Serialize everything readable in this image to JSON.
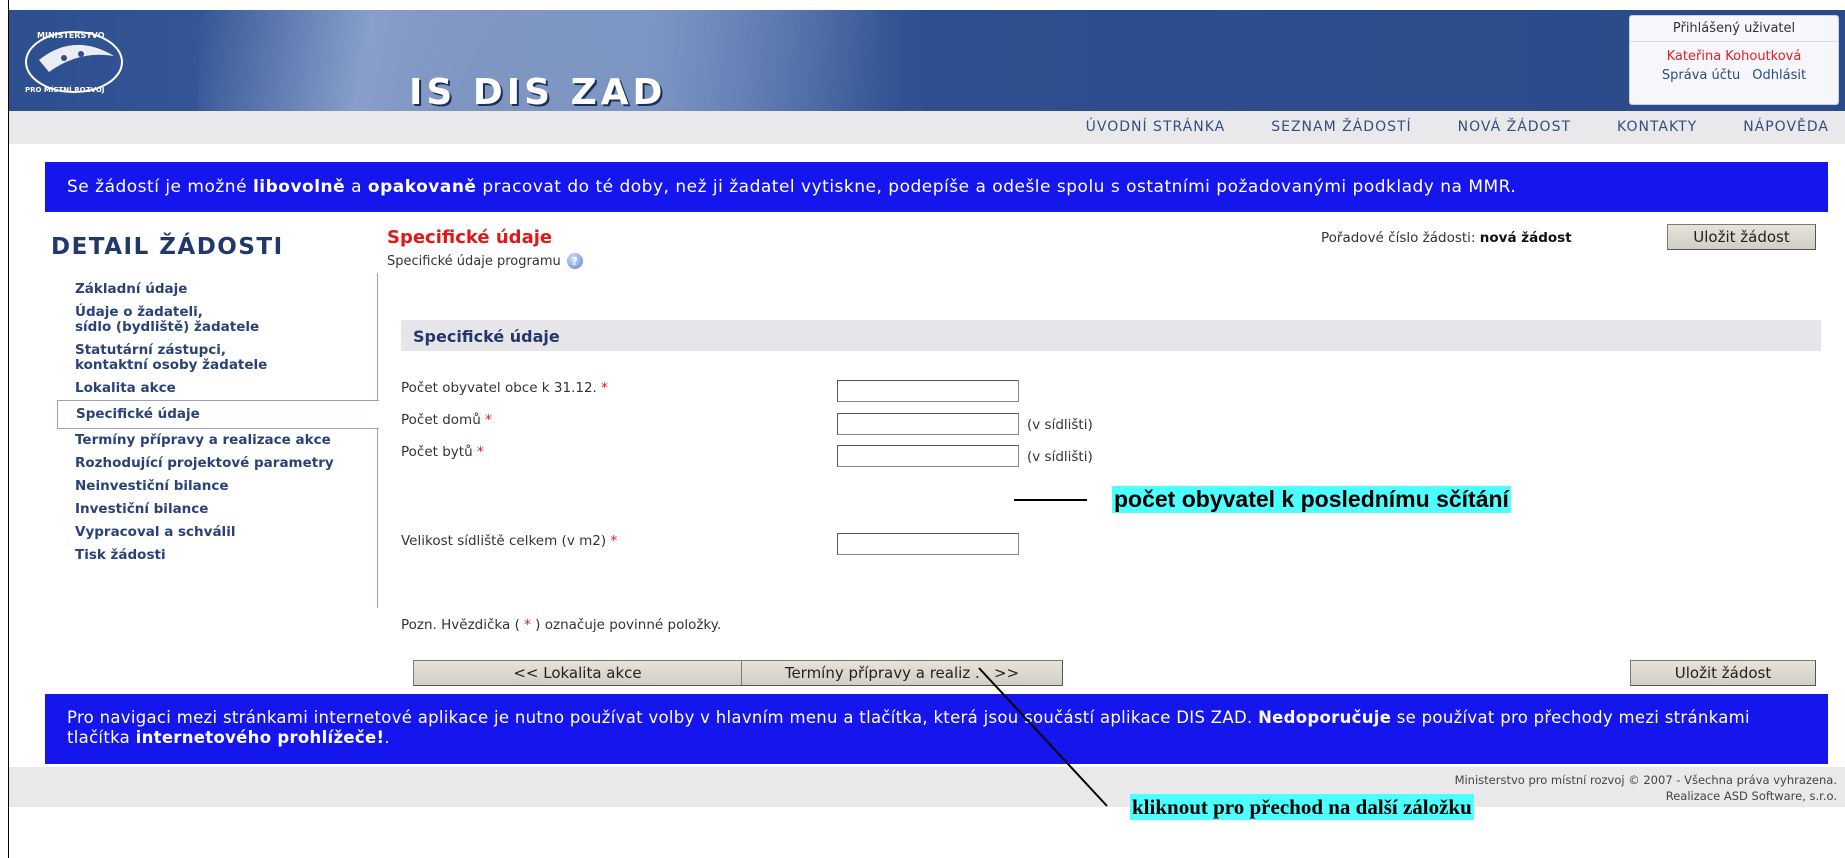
{
  "header": {
    "logo_text_top": "MINISTERSTVO",
    "logo_text_bottom": "PRO MÍSTNÍ ROZVOJ",
    "app_title": "IS DIS ZAD",
    "user_box_title": "Přihlášený uživatel",
    "user_name": "Kateřina Kohoutková",
    "account_link": "Správa účtu",
    "logout_link": "Odhlásit"
  },
  "nav": {
    "items": [
      "ÚVODNÍ STRÁNKA",
      "SEZNAM ŽÁDOSTÍ",
      "NOVÁ ŽÁDOST",
      "KONTAKTY",
      "NÁPOVĚDA"
    ]
  },
  "banner_top": {
    "p1": "Se žádostí je možné ",
    "b1": "libovolně",
    "p2": " a ",
    "b2": "opakovaně",
    "p3": " pracovat do té doby, než ji žadatel vytiskne, podepíše a odešle spolu s ostatními požadovanými podklady na MMR."
  },
  "sidebar": {
    "title": "DETAIL ŽÁDOSTI",
    "items": [
      {
        "line1": "Základní údaje",
        "line2": ""
      },
      {
        "line1": "Údaje o žadateli,",
        "line2": "sídlo (bydliště) žadatele"
      },
      {
        "line1": "Statutární zástupci,",
        "line2": "kontaktní osoby žadatele"
      },
      {
        "line1": "Lokalita akce",
        "line2": ""
      },
      {
        "line1": "Specifické údaje",
        "line2": ""
      },
      {
        "line1": "Termíny přípravy a realizace akce",
        "line2": ""
      },
      {
        "line1": "Rozhodující projektové parametry",
        "line2": ""
      },
      {
        "line1": "Neinvestiční bilance",
        "line2": ""
      },
      {
        "line1": "Investiční bilance",
        "line2": ""
      },
      {
        "line1": "Vypracoval a schválil",
        "line2": ""
      },
      {
        "line1": "Tisk žádosti",
        "line2": ""
      }
    ]
  },
  "content": {
    "section_title": "Specifické údaje",
    "section_subtitle": "Specifické údaje programu",
    "order_label": "Pořadové číslo žádosti: ",
    "order_value": "nová žádost",
    "save_button": "Uložit žádost",
    "panel_title": "Specifické údaje",
    "required_mark": "*",
    "fields": [
      {
        "label": "Počet obyvatel obce k 31.12.",
        "value": "",
        "suffix": ""
      },
      {
        "label": "Počet domů",
        "value": "",
        "suffix": "(v sídlišti)"
      },
      {
        "label": "Počet bytů",
        "value": "",
        "suffix": "(v sídlišti)"
      },
      {
        "label": "Velikost sídliště celkem (v m2)",
        "value": "",
        "suffix": ""
      }
    ],
    "note_prefix": "Pozn. Hvězdička ( ",
    "note_star": "*",
    "note_suffix": " ) označuje povinné položky.",
    "prev_button": "<< Lokalita akce",
    "next_button": "Termíny přípravy a realiz . . >>",
    "save_button_bottom": "Uložit žádost"
  },
  "banner_bottom": {
    "p1": "Pro navigaci mezi stránkami internetové aplikace je nutno používat volby v hlavním menu a tlačítka, která jsou součástí aplikace DIS ZAD. ",
    "b1": "Nedoporučuje",
    "p2": " se používat pro přechody mezi stránkami tlačítka ",
    "b2": "internetového prohlížeče!",
    "p3": "."
  },
  "footer": {
    "line1": "Ministerstvo pro místní rozvoj © 2007 - Všechna práva vyhrazena.",
    "line2": "Realizace ASD Software, s.r.o."
  },
  "annotations": {
    "population_note": "počet obyvatel k poslednímu sčítání",
    "click_note": "kliknout pro přechod na další záložku"
  },
  "colors": {
    "banner_blue": "#1515ee",
    "header_blue": "#2d4f90",
    "title_red": "#e01818",
    "annotation_cyan": "#4dfffe"
  }
}
